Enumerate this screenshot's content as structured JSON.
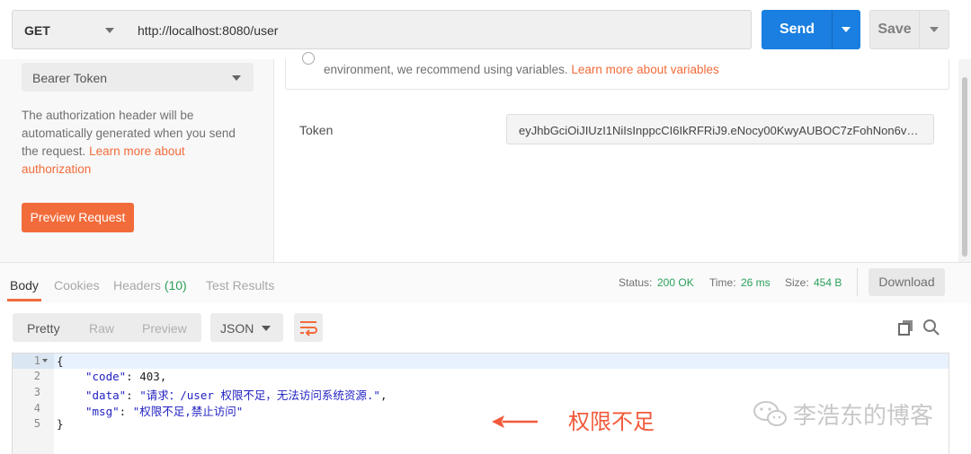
{
  "request": {
    "method": "GET",
    "url": "http://localhost:8080/user",
    "send_label": "Send",
    "save_label": "Save"
  },
  "auth": {
    "type": "Bearer Token",
    "desc_text": "The authorization header will be automatically generated when you send the request. ",
    "desc_link": "Learn more about authorization",
    "preview_label": "Preview Request",
    "note_text": "environment, we recommend using variables. ",
    "note_link": "Learn more about variables",
    "token_label": "Token",
    "token_value": "eyJhbGciOiJIUzI1NiIsInppcCI6IkRFRiJ9.eNocy00KwyAUBOC7zFohNon6vE…"
  },
  "response": {
    "tabs": {
      "body": "Body",
      "cookies": "Cookies",
      "headers": "Headers",
      "headers_count": "(10)",
      "tests": "Test Results"
    },
    "status_label": "Status:",
    "status_value": "200 OK",
    "time_label": "Time:",
    "time_value": "26 ms",
    "size_label": "Size:",
    "size_value": "454 B",
    "download_label": "Download",
    "formats": [
      "Pretty",
      "Raw",
      "Preview"
    ],
    "json_label": "JSON",
    "line_numbers": [
      "1",
      "2",
      "3",
      "4",
      "5"
    ],
    "code": {
      "open": "{",
      "code_key": "\"code\"",
      "code_val": "403",
      "data_key": "\"data\"",
      "data_val": "\"请求：/user 权限不足，无法访问系统资源.\"",
      "msg_key": "\"msg\"",
      "msg_val": "\"权限不足,禁止访问\"",
      "close": "}"
    }
  },
  "annotation": {
    "text": "权限不足",
    "color": "#f25a3a"
  },
  "watermark": "李浩东的博客",
  "colors": {
    "accent": "#f26b3a",
    "send": "#1a7fe0",
    "status_ok": "#2aa05a"
  }
}
